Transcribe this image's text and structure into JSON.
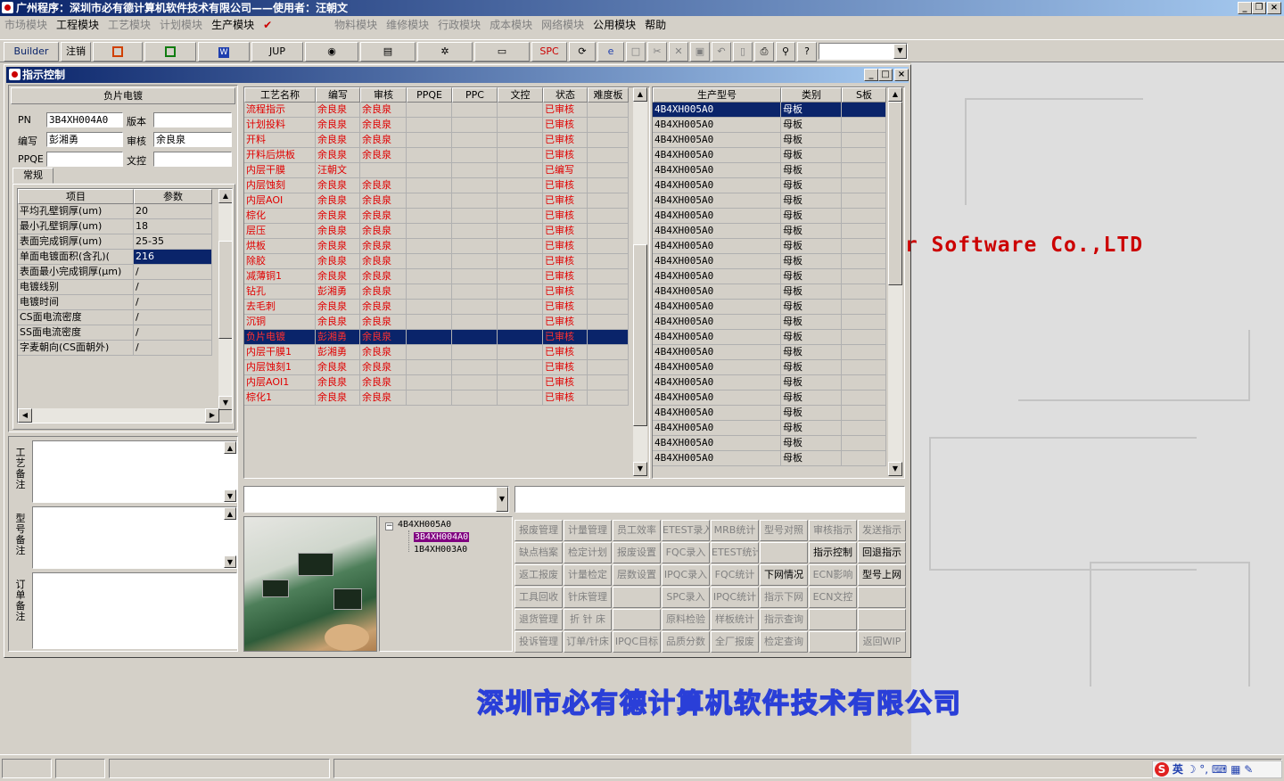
{
  "app": {
    "title": "广州程序：深圳市必有德计算机软件技术有限公司——使用者：汪朝文"
  },
  "menu": [
    {
      "label": "市场模块",
      "enabled": false
    },
    {
      "label": "工程模块",
      "enabled": true
    },
    {
      "label": "工艺模块",
      "enabled": false
    },
    {
      "label": "计划模块",
      "enabled": false
    },
    {
      "label": "生产模块",
      "enabled": true
    },
    {
      "label": "物料模块",
      "enabled": false
    },
    {
      "label": "维修模块",
      "enabled": false
    },
    {
      "label": "行政模块",
      "enabled": false
    },
    {
      "label": "成本模块",
      "enabled": false
    },
    {
      "label": "网络模块",
      "enabled": false
    },
    {
      "label": "公用模块",
      "enabled": true
    },
    {
      "label": "帮助",
      "enabled": true
    }
  ],
  "toolbar": {
    "builder": "Builder",
    "logout": "注销",
    "jup": "JUP",
    "spc": "SPC"
  },
  "window": {
    "title": "指示控制"
  },
  "left": {
    "group_title": "负片电镀",
    "pn_label": "PN",
    "pn_value": "3B4XH004A0",
    "version_label": "版本",
    "version_value": "",
    "author_label": "编写",
    "author_value": "彭湘勇",
    "review_label": "审核",
    "review_value": "余良泉",
    "ppqe_label": "PPQE",
    "ppqe_value": "",
    "wenkong_label": "文控",
    "wenkong_value": "",
    "tab_label": "常规",
    "param_headers": [
      "项目",
      "参数"
    ],
    "params": [
      {
        "name": "平均孔壁铜厚(um)",
        "value": "20"
      },
      {
        "name": "最小孔壁铜厚(um)",
        "value": "18"
      },
      {
        "name": "表面完成铜厚(um)",
        "value": "25-35"
      },
      {
        "name": "单面电镀面积(含孔)(",
        "value": "216"
      },
      {
        "name": "表面最小完成铜厚(μm)",
        "value": "/"
      },
      {
        "name": "电镀线别",
        "value": "/"
      },
      {
        "name": "电镀时间",
        "value": "/"
      },
      {
        "name": "CS面电流密度",
        "value": "/"
      },
      {
        "name": "SS面电流密度",
        "value": "/"
      },
      {
        "name": "字麦朝向(CS面朝外)",
        "value": "/"
      }
    ],
    "remark_labels": [
      "工艺备注",
      "型号备注",
      "订单备注"
    ]
  },
  "process": {
    "headers": [
      "工艺名称",
      "编写",
      "审核",
      "PPQE",
      "PPC",
      "文控",
      "状态",
      "难度板"
    ],
    "rows": [
      [
        "流程指示",
        "余良泉",
        "余良泉",
        "",
        "",
        "",
        "已审核",
        ""
      ],
      [
        "计划投料",
        "余良泉",
        "余良泉",
        "",
        "",
        "",
        "已审核",
        ""
      ],
      [
        "开料",
        "余良泉",
        "余良泉",
        "",
        "",
        "",
        "已审核",
        ""
      ],
      [
        "开料后烘板",
        "余良泉",
        "余良泉",
        "",
        "",
        "",
        "已审核",
        ""
      ],
      [
        "内层干膜",
        "汪朝文",
        "",
        "",
        "",
        "",
        "已编写",
        ""
      ],
      [
        "内层蚀刻",
        "余良泉",
        "余良泉",
        "",
        "",
        "",
        "已审核",
        ""
      ],
      [
        "内层AOI",
        "余良泉",
        "余良泉",
        "",
        "",
        "",
        "已审核",
        ""
      ],
      [
        "棕化",
        "余良泉",
        "余良泉",
        "",
        "",
        "",
        "已审核",
        ""
      ],
      [
        "层压",
        "余良泉",
        "余良泉",
        "",
        "",
        "",
        "已审核",
        ""
      ],
      [
        "烘板",
        "余良泉",
        "余良泉",
        "",
        "",
        "",
        "已审核",
        ""
      ],
      [
        "除胶",
        "余良泉",
        "余良泉",
        "",
        "",
        "",
        "已审核",
        ""
      ],
      [
        "减薄铜1",
        "余良泉",
        "余良泉",
        "",
        "",
        "",
        "已审核",
        ""
      ],
      [
        "钻孔",
        "彭湘勇",
        "余良泉",
        "",
        "",
        "",
        "已审核",
        ""
      ],
      [
        "去毛刺",
        "余良泉",
        "余良泉",
        "",
        "",
        "",
        "已审核",
        ""
      ],
      [
        "沉铜",
        "余良泉",
        "余良泉",
        "",
        "",
        "",
        "已审核",
        ""
      ],
      [
        "负片电镀",
        "彭湘勇",
        "余良泉",
        "",
        "",
        "",
        "已审核",
        ""
      ],
      [
        "内层干膜1",
        "彭湘勇",
        "余良泉",
        "",
        "",
        "",
        "已审核",
        ""
      ],
      [
        "内层蚀刻1",
        "余良泉",
        "余良泉",
        "",
        "",
        "",
        "已审核",
        ""
      ],
      [
        "内层AOI1",
        "余良泉",
        "余良泉",
        "",
        "",
        "",
        "已审核",
        ""
      ],
      [
        "棕化1",
        "余良泉",
        "余良泉",
        "",
        "",
        "",
        "已审核",
        ""
      ]
    ],
    "selected_index": 15
  },
  "models": {
    "headers": [
      "生产型号",
      "类别",
      "S板"
    ],
    "rows": [
      [
        "4B4XH005A0",
        "母板",
        ""
      ],
      [
        "4B4XH005A0",
        "母板",
        ""
      ],
      [
        "4B4XH005A0",
        "母板",
        ""
      ],
      [
        "4B4XH005A0",
        "母板",
        ""
      ],
      [
        "4B4XH005A0",
        "母板",
        ""
      ],
      [
        "4B4XH005A0",
        "母板",
        ""
      ],
      [
        "4B4XH005A0",
        "母板",
        ""
      ],
      [
        "4B4XH005A0",
        "母板",
        ""
      ],
      [
        "4B4XH005A0",
        "母板",
        ""
      ],
      [
        "4B4XH005A0",
        "母板",
        ""
      ],
      [
        "4B4XH005A0",
        "母板",
        ""
      ],
      [
        "4B4XH005A0",
        "母板",
        ""
      ],
      [
        "4B4XH005A0",
        "母板",
        ""
      ],
      [
        "4B4XH005A0",
        "母板",
        ""
      ],
      [
        "4B4XH005A0",
        "母板",
        ""
      ],
      [
        "4B4XH005A0",
        "母板",
        ""
      ],
      [
        "4B4XH005A0",
        "母板",
        ""
      ],
      [
        "4B4XH005A0",
        "母板",
        ""
      ],
      [
        "4B4XH005A0",
        "母板",
        ""
      ],
      [
        "4B4XH005A0",
        "母板",
        ""
      ],
      [
        "4B4XH005A0",
        "母板",
        ""
      ],
      [
        "4B4XH005A0",
        "母板",
        ""
      ],
      [
        "4B4XH005A0",
        "母板",
        ""
      ],
      [
        "4B4XH005A0",
        "母板",
        ""
      ]
    ],
    "selected_index": 0
  },
  "tree": {
    "root": "4B4XH005A0",
    "children": [
      "3B4XH004A0",
      "1B4XH003A0"
    ],
    "selected_child": 0
  },
  "buttons": [
    [
      "报废管理",
      "计量管理",
      "员工效率",
      "ETEST录入",
      "MRB统计",
      "型号对照",
      "审核指示",
      "发送指示"
    ],
    [
      "缺点档案",
      "检定计划",
      "报废设置",
      "FQC录入",
      "ETEST统计",
      "",
      "指示控制",
      "回退指示"
    ],
    [
      "返工报废",
      "计量检定",
      "层数设置",
      "IPQC录入",
      "FQC统计",
      "下网情况",
      "ECN影响",
      "型号上网"
    ],
    [
      "工具回收",
      "针床管理",
      "",
      "SPC录入",
      "IPQC统计",
      "指示下网",
      "ECN文控",
      ""
    ],
    [
      "退货管理",
      "折 针 床",
      "",
      "原料检验",
      "样板统计",
      "指示查询",
      "",
      ""
    ],
    [
      "投诉管理",
      "订单/针床",
      "IPQC目标",
      "品质分数",
      "全厂报废",
      "检定查询",
      "",
      "返回WIP"
    ]
  ],
  "enabled_buttons": [
    "下网情况",
    "指示控制",
    "回退指示",
    "型号上网"
  ],
  "background": {
    "slogan": "er Software Co.,LTD",
    "company": "深圳市必有德计算机软件技术有限公司"
  },
  "tray": {
    "ime": "英"
  }
}
